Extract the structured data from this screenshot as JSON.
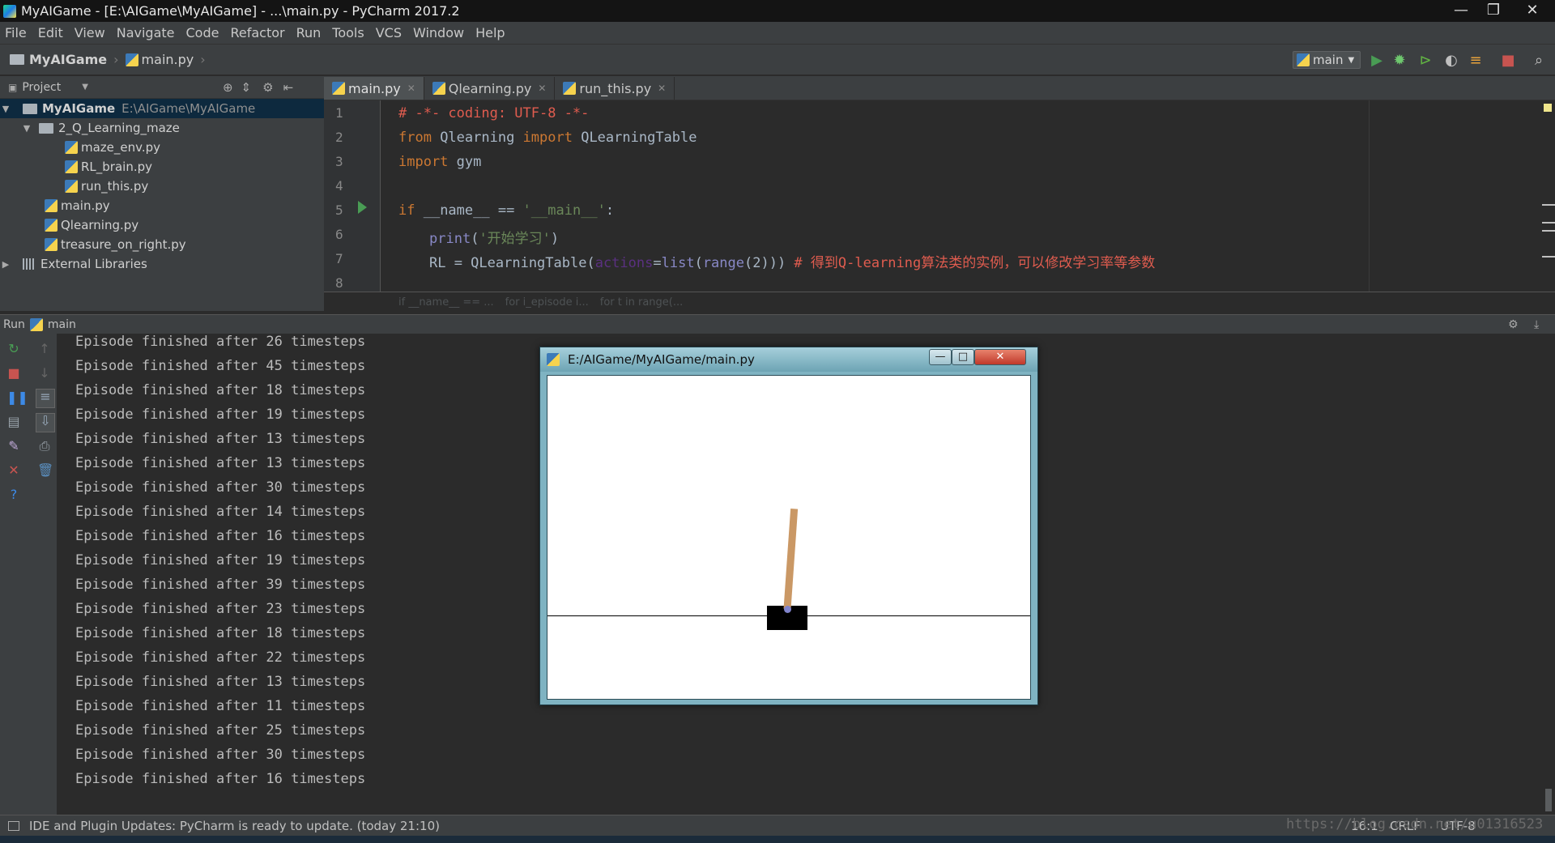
{
  "window": {
    "title": "MyAIGame - [E:\\AIGame\\MyAIGame] - ...\\main.py - PyCharm 2017.2"
  },
  "menu": [
    "File",
    "Edit",
    "View",
    "Navigate",
    "Code",
    "Refactor",
    "Run",
    "Tools",
    "VCS",
    "Window",
    "Help"
  ],
  "breadcrumb": {
    "project": "MyAIGame",
    "file": "main.py"
  },
  "run_config": {
    "name": "main"
  },
  "project_panel": {
    "title": "Project",
    "root": {
      "name": "MyAIGame",
      "path": "E:\\AIGame\\MyAIGame"
    },
    "folder": "2_Q_Learning_maze",
    "folder_files": [
      "maze_env.py",
      "RL_brain.py",
      "run_this.py"
    ],
    "root_files": [
      "main.py",
      "Qlearning.py",
      "treasure_on_right.py"
    ],
    "external": "External Libraries"
  },
  "tabs": [
    "main.py",
    "Qlearning.py",
    "run_this.py"
  ],
  "code": {
    "line_numbers": [
      "1",
      "2",
      "3",
      "4",
      "5",
      "6",
      "7",
      "8"
    ],
    "l1": "# -*- coding: UTF-8 -*-",
    "l2_from": "from",
    "l2_mod": " Qlearning ",
    "l2_import": "import",
    "l2_name": " QLearningTable",
    "l3_import": "import",
    "l3_name": " gym",
    "l5_if": "if",
    "l5_rest": " __name__ == ",
    "l5_str": "'__main__'",
    "l5_colon": ":",
    "l6_fn": "print",
    "l6_open": "(",
    "l6_str": "'开始学习'",
    "l6_close": ")",
    "l7_a": "RL = QLearningTable(",
    "l7_kw": "actions",
    "l7_b": "=",
    "l7_list": "list",
    "l7_c": "(",
    "l7_range": "range",
    "l7_d": "(2)))",
    "l7_cm": " # 得到Q-learning算法类的实例，可以修改学习率等参数"
  },
  "editor_crumbs": [
    "if __name__ == ...",
    "for i_episode i...",
    "for t in range(..."
  ],
  "run_panel": {
    "label": "Run",
    "config": "main",
    "output": [
      "Episode finished after 26 timesteps",
      "Episode finished after 45 timesteps",
      "Episode finished after 18 timesteps",
      "Episode finished after 19 timesteps",
      "Episode finished after 13 timesteps",
      "Episode finished after 13 timesteps",
      "Episode finished after 30 timesteps",
      "Episode finished after 14 timesteps",
      "Episode finished after 16 timesteps",
      "Episode finished after 19 timesteps",
      "Episode finished after 39 timesteps",
      "Episode finished after 23 timesteps",
      "Episode finished after 18 timesteps",
      "Episode finished after 22 timesteps",
      "Episode finished after 13 timesteps",
      "Episode finished after 11 timesteps",
      "Episode finished after 25 timesteps",
      "Episode finished after 30 timesteps",
      "Episode finished after 16 timesteps"
    ]
  },
  "gym_window": {
    "title": "E:/AIGame/MyAIGame/main.py"
  },
  "status": {
    "message": "IDE and Plugin Updates: PyCharm is ready to update. (today 21:10)",
    "position": "16:1",
    "line_sep": "CRLF",
    "encoding": "UTF-8",
    "watermark": "https://blog.csdn.net/u01316523"
  },
  "colors": {
    "keyword": "#cc7832",
    "comment": "#e05c4f",
    "string": "#6a8759",
    "run_green": "#499c54",
    "stop_red": "#c75450"
  }
}
